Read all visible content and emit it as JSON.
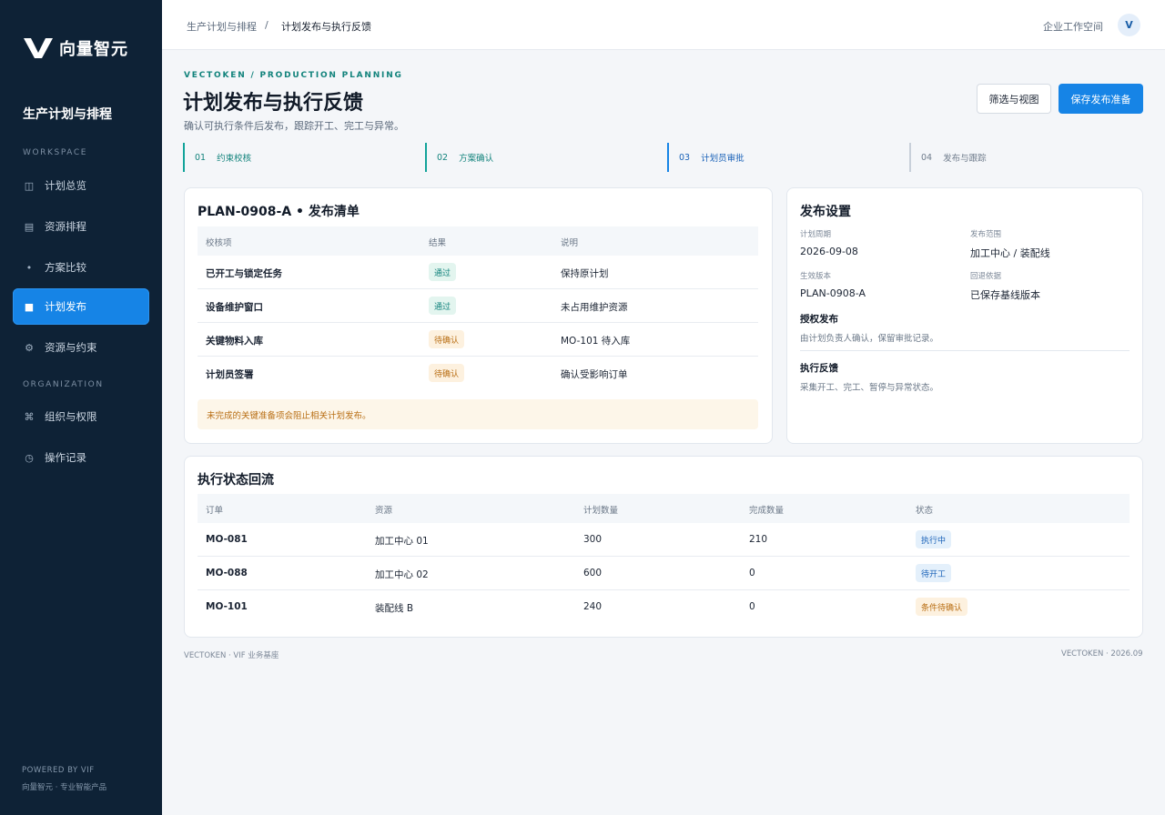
{
  "sidebar": {
    "brand": "向量智元",
    "module_title": "生产计划与排程",
    "workspace_label": "WORKSPACE",
    "organization_label": "ORGANIZATION",
    "items": [
      {
        "label": "计划总览",
        "icon": "columns-icon"
      },
      {
        "label": "资源排程",
        "icon": "list-icon"
      },
      {
        "label": "方案比较",
        "icon": "dot-icon"
      },
      {
        "label": "计划发布",
        "icon": "square-icon",
        "active": true
      },
      {
        "label": "资源与约束",
        "icon": "gear-icon"
      },
      {
        "label": "组织与权限",
        "icon": "command-icon"
      },
      {
        "label": "操作记录",
        "icon": "clock-icon"
      }
    ],
    "footer_powered": "POWERED BY VIF",
    "footer_product": "向量智元 · 专业智能产品"
  },
  "topbar": {
    "crumb_parent": "生产计划与排程",
    "crumb_sep": "/",
    "crumb_current": "计划发布与执行反馈",
    "workspace": "企业工作空间",
    "avatar": "V"
  },
  "header": {
    "eyebrow": "VECTOKEN / PRODUCTION PLANNING",
    "title": "计划发布与执行反馈",
    "subtitle": "确认可执行条件后发布，跟踪开工、完工与异常。",
    "filter_button": "筛选与视图",
    "save_button": "保存发布准备"
  },
  "steps": [
    {
      "num": "01",
      "label": "约束校核"
    },
    {
      "num": "02",
      "label": "方案确认"
    },
    {
      "num": "03",
      "label": "计划员审批"
    },
    {
      "num": "04",
      "label": "发布与跟踪"
    }
  ],
  "checklist": {
    "title": "PLAN-0908-A • 发布清单",
    "headers": [
      "校核项",
      "结果",
      "说明"
    ],
    "rows": [
      {
        "item": "已开工与锁定任务",
        "result": "通过",
        "note": "保持原计划"
      },
      {
        "item": "设备维护窗口",
        "result": "通过",
        "note": "未占用维护资源"
      },
      {
        "item": "关键物料入库",
        "result": "待确认",
        "note": "MO-101 待入库"
      },
      {
        "item": "计划员签署",
        "result": "待确认",
        "note": "确认受影响订单"
      }
    ],
    "notice": "未完成的关键准备项会阻止相关计划发布。"
  },
  "settings": {
    "title": "发布设置",
    "period_label": "计划周期",
    "period_value": "2026-09-08",
    "scope_label": "发布范围",
    "scope_value": "加工中心 / 装配线",
    "version_label": "生效版本",
    "version_value": "PLAN-0908-A",
    "rollback_label": "回退依据",
    "rollback_value": "已保存基线版本",
    "auth_title": "授权发布",
    "auth_text": "由计划负责人确认，保留审批记录。",
    "feedback_title": "执行反馈",
    "feedback_text": "采集开工、完工、暂停与异常状态。"
  },
  "execution": {
    "title": "执行状态回流",
    "headers": [
      "订单",
      "资源",
      "计划数量",
      "完成数量",
      "状态"
    ],
    "rows": [
      {
        "order": "MO-081",
        "resource": "加工中心 01",
        "planned": "300",
        "done": "210",
        "status": "执行中"
      },
      {
        "order": "MO-088",
        "resource": "加工中心 02",
        "planned": "600",
        "done": "0",
        "status": "待开工"
      },
      {
        "order": "MO-101",
        "resource": "装配线 B",
        "planned": "240",
        "done": "0",
        "status": "条件待确认"
      }
    ]
  },
  "footer": {
    "left": "VECTOKEN · VIF 业务基座",
    "right": "VECTOKEN · 2026.09"
  },
  "colors": {
    "sidebar_bg": "#0e2236",
    "accent": "#1684e6",
    "teal": "#12837c",
    "warn": "#b86d12"
  }
}
